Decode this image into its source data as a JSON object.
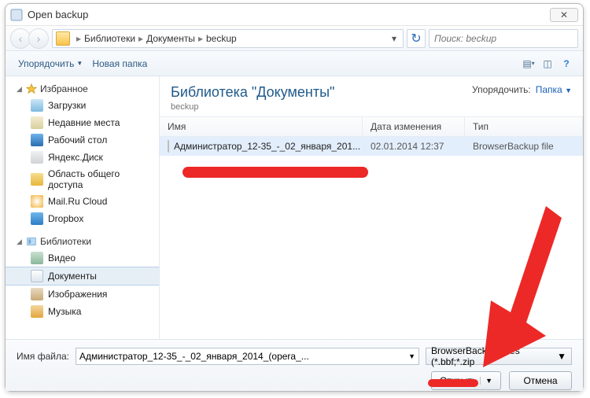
{
  "title": "Open backup",
  "breadcrumb": {
    "p1": "Библиотеки",
    "p2": "Документы",
    "p3": "beckup"
  },
  "search": {
    "placeholder": "Поиск: beckup"
  },
  "toolbar": {
    "organize": "Упорядочить",
    "newfolder": "Новая папка"
  },
  "sidebar": {
    "favorites": "Избранное",
    "fav": {
      "downloads": "Загрузки",
      "recent": "Недавние места",
      "desktop": "Рабочий стол",
      "yadisk": "Яндекс.Диск",
      "public": "Область общего доступа",
      "mailru": "Mail.Ru Cloud",
      "dropbox": "Dropbox"
    },
    "libraries": "Библиотеки",
    "lib": {
      "videos": "Видео",
      "documents": "Документы",
      "pictures": "Изображения",
      "music": "Музыка"
    }
  },
  "libheader": {
    "title": "Библиотека \"Документы\"",
    "subtitle": "beckup",
    "sort_label": "Упорядочить:",
    "sort_value": "Папка"
  },
  "columns": {
    "name": "Имя",
    "modified": "Дата изменения",
    "type": "Тип"
  },
  "rows": [
    {
      "name": "Администратор_12-35_-_02_января_201...",
      "modified": "02.01.2014 12:37",
      "type": "BrowserBackup file"
    }
  ],
  "file": {
    "label": "Имя файла:",
    "value": "Администратор_12-35_-_02_января_2014_(opera_...",
    "filter": "BrowserBackup Files (*.bbf;*.zip"
  },
  "buttons": {
    "open": "Открыть",
    "cancel": "Отмена"
  }
}
